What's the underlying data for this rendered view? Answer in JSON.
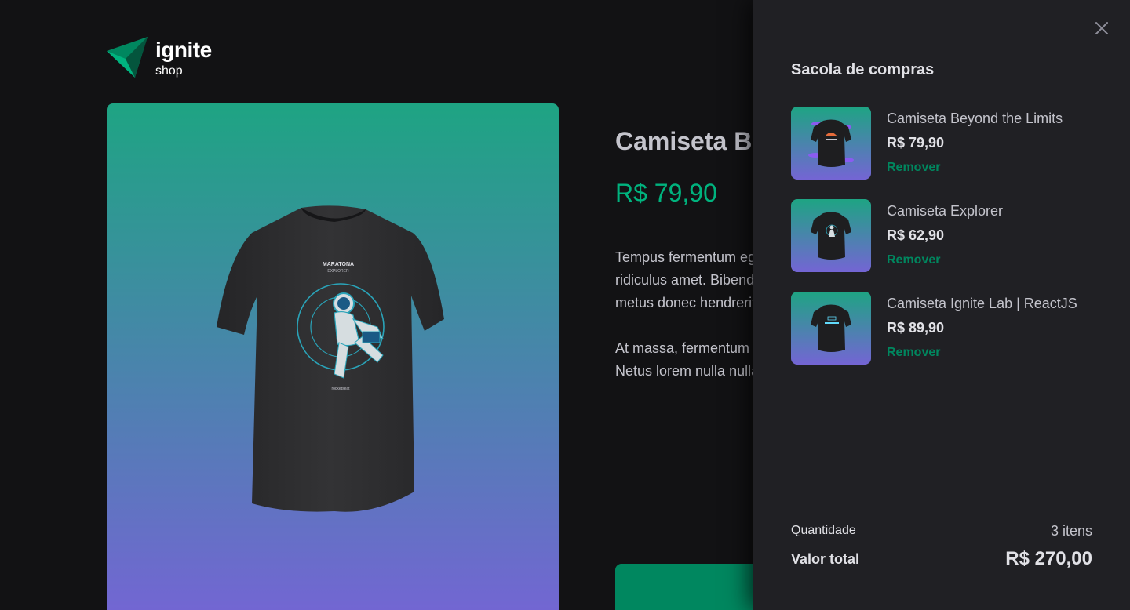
{
  "header": {
    "logo_name": "ignite",
    "logo_sub": "shop"
  },
  "colors": {
    "accent": "#00b37e",
    "accent_dark": "#00875f",
    "background": "#121214",
    "drawer": "#202024",
    "gradient_top": "#1ea483",
    "gradient_bottom": "#7465d4"
  },
  "product": {
    "title": "Camiseta Be",
    "price": "R$ 79,90",
    "description": [
      "Tempus fermentum eg",
      "ridiculus amet. Bibend",
      "metus donec hendrerit"
    ],
    "description_2": [
      "At massa, fermentum",
      "Netus lorem nulla nulla"
    ],
    "shirt_print_title": "MARATONA",
    "shirt_print_sub": "EXPLORER",
    "shirt_brand": "rocketseat"
  },
  "cart": {
    "title": "Sacola de compras",
    "close_icon": "close-icon",
    "items": [
      {
        "name": "Camiseta Beyond the Limits",
        "price": "R$ 79,90",
        "remove_label": "Remover"
      },
      {
        "name": "Camiseta Explorer",
        "price": "R$ 62,90",
        "remove_label": "Remover"
      },
      {
        "name": "Camiseta Ignite Lab | ReactJS",
        "price": "R$ 89,90",
        "remove_label": "Remover"
      }
    ],
    "quantity_label": "Quantidade",
    "quantity_value": "3 itens",
    "total_label": "Valor total",
    "total_value": "R$ 270,00"
  }
}
